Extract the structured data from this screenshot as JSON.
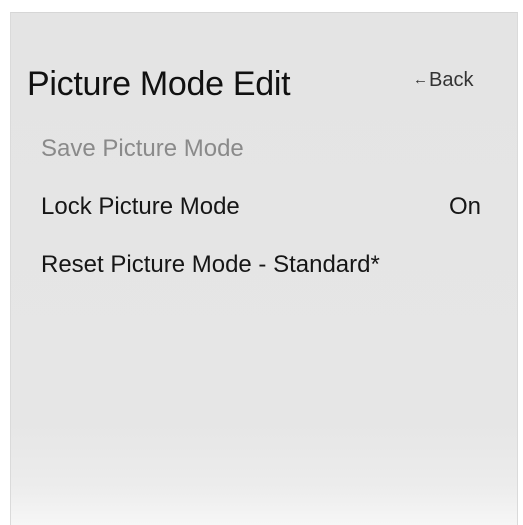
{
  "header": {
    "title": "Picture Mode Edit",
    "back_label": "Back",
    "back_icon": "left-arrow-icon"
  },
  "menu": {
    "items": [
      {
        "label": "Save Picture Mode",
        "value": "",
        "disabled": true
      },
      {
        "label": "Lock Picture Mode",
        "value": "On",
        "disabled": false
      },
      {
        "label": "Reset Picture Mode - Standard*",
        "value": "",
        "disabled": false
      }
    ]
  },
  "colors": {
    "panel_background": "#e4e4e4",
    "text_primary": "#161616",
    "text_disabled": "#8a8a8a"
  }
}
